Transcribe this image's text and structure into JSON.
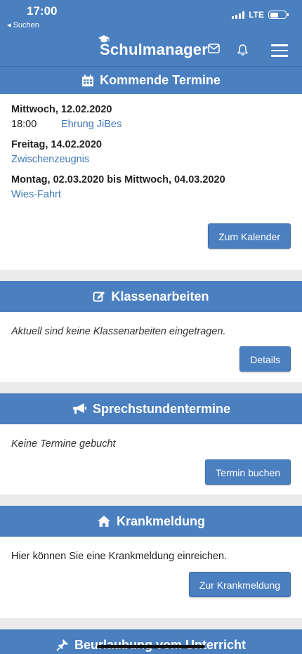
{
  "status": {
    "time": "17:00",
    "back": "◂ Suchen",
    "network": "LTE"
  },
  "nav": {
    "title": "Schulmanager"
  },
  "upcoming": {
    "title": "Kommende Termine",
    "events": [
      {
        "date": "Mittwoch, 12.02.2020",
        "time": "18:00",
        "name": "Ehrung JiBes"
      },
      {
        "date": "Freitag, 14.02.2020",
        "time": "",
        "name": "Zwischenzeugnis"
      },
      {
        "date": "Montag, 02.03.2020 bis Mittwoch, 04.03.2020",
        "time": "",
        "name": "Wies-Fahrt"
      }
    ],
    "button": "Zum Kalender"
  },
  "exams": {
    "title": "Klassenarbeiten",
    "text": "Aktuell sind keine Klassenarbeiten eingetragen.",
    "button": "Details"
  },
  "consultation": {
    "title": "Sprechstundentermine",
    "text": "Keine Termine gebucht",
    "button": "Termin buchen"
  },
  "sickness": {
    "title": "Krankmeldung",
    "text": "Hier können Sie eine Krankmeldung einreichen.",
    "button": "Zur Krankmeldung"
  },
  "leave": {
    "title": "Beurlaubung vom Unterricht"
  },
  "colors": {
    "primary": "#4a7fc0",
    "link": "#3f78b8",
    "background": "#ebebeb"
  }
}
